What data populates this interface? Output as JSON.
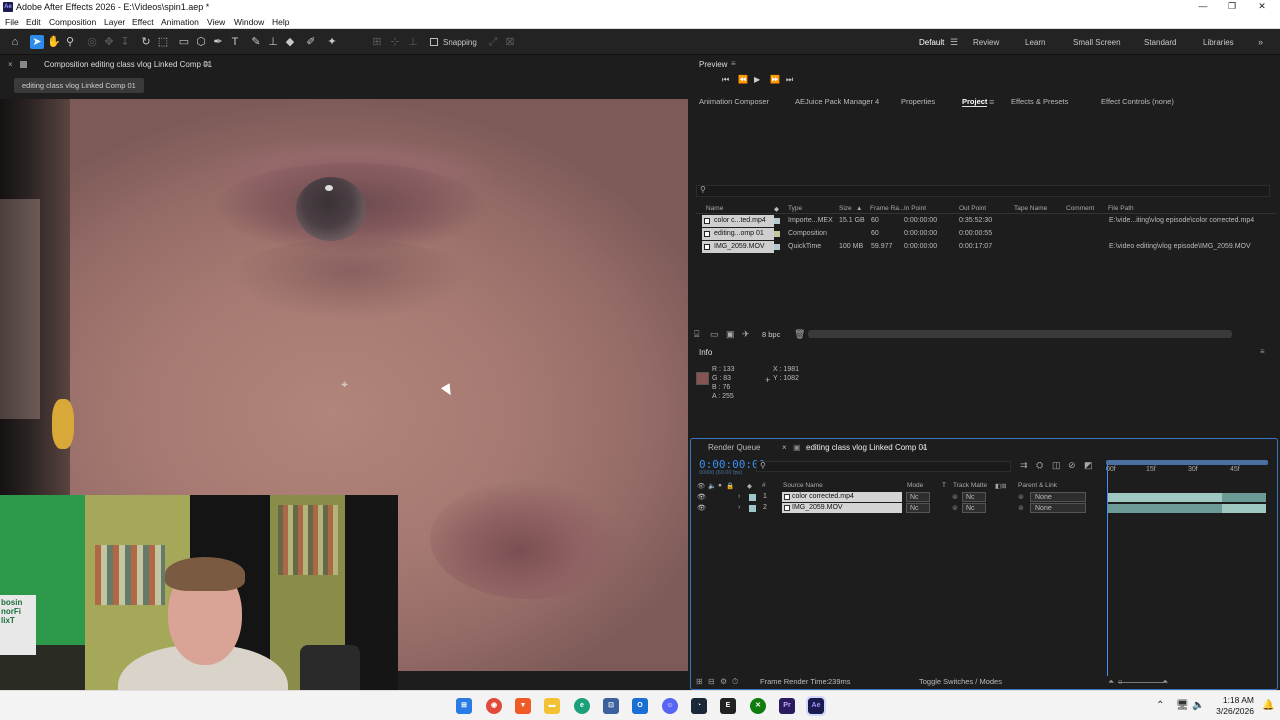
{
  "window": {
    "title": "Adobe After Effects 2026 - E:\\Videos\\spin1.aep *",
    "controls": [
      "minimize",
      "restore",
      "close"
    ]
  },
  "menu": [
    "File",
    "Edit",
    "Composition",
    "Layer",
    "Effect",
    "Animation",
    "View",
    "Window",
    "Help"
  ],
  "toolbar": {
    "snapping_label": "Snapping",
    "workspaces": [
      "Default",
      "Review",
      "Learn",
      "Small Screen",
      "Standard",
      "Libraries"
    ],
    "active_workspace": "Default"
  },
  "composition": {
    "panel_title": "Composition editing class vlog Linked Comp 01",
    "breadcrumb": "editing class vlog Linked Comp 01"
  },
  "webcam": {
    "sign_text": "bosin\nnorFi\nlixT"
  },
  "preview": {
    "title": "Preview"
  },
  "tabs": [
    "Animation Composer",
    "AEJuice Pack Manager 4",
    "Properties",
    "Project",
    "Effects & Presets",
    "Effect Controls (none)"
  ],
  "active_tab": "Project",
  "project": {
    "columns": [
      "Name",
      "Type",
      "Size",
      "Frame Ra...",
      "In Point",
      "Out Point",
      "Tape Name",
      "Comment",
      "File Path"
    ],
    "rows": [
      {
        "name": "color c...ted.mp4",
        "type": "Importe...MEX",
        "size": "15.1 GB",
        "fps": "60",
        "in": "0:00:00:00",
        "out": "0:35:52:30",
        "path": "E:\\vide...iting\\vlog episode\\color corrected.mp4"
      },
      {
        "name": "editing...omp 01",
        "type": "Composition",
        "size": "",
        "fps": "60",
        "in": "0:00:00:00",
        "out": "0:00:00:55",
        "path": ""
      },
      {
        "name": "IMG_2059.MOV",
        "type": "QuickTime",
        "size": "100 MB",
        "fps": "59.977",
        "in": "0:00:00:00",
        "out": "0:00:17:07",
        "path": "E:\\video editing\\vlog episode\\IMG_2059.MOV"
      }
    ],
    "bpc": "8 bpc"
  },
  "info": {
    "title": "Info",
    "r": "R : 133",
    "g": "G : 83",
    "b": "B : 76",
    "a": "A : 255",
    "x": "X : 1981",
    "y": "Y : 1082",
    "swatch_color": "#855350"
  },
  "timeline": {
    "render_queue_tab": "Render Queue",
    "comp_tab": "editing class vlog Linked Comp 01",
    "current_time": "0:00:00:00",
    "fps_note": "00000 (60.00 fps)",
    "columns": [
      "#",
      "Source Name",
      "Mode",
      "T",
      "Track Matte",
      "Parent & Link"
    ],
    "ruler_labels": [
      "00f",
      "15f",
      "30f",
      "45f"
    ],
    "layers": [
      {
        "num": "1",
        "name": "color corrected.mp4",
        "mode": "Nc",
        "matte": "Nc",
        "parent": "None"
      },
      {
        "num": "2",
        "name": "IMG_2059.MOV",
        "mode": "Nc",
        "matte": "Nc",
        "parent": "None"
      }
    ],
    "frame_render_label": "Frame Render Time:",
    "frame_render_value": "239ms",
    "toggle_label": "Toggle Switches / Modes"
  },
  "taskbar": {
    "time": "1:18 AM",
    "date": "3/26/2026"
  },
  "colors": {
    "accent": "#2d8ceb",
    "timecode": "#3a8ff0",
    "panel_bg": "#1d1d1d"
  }
}
